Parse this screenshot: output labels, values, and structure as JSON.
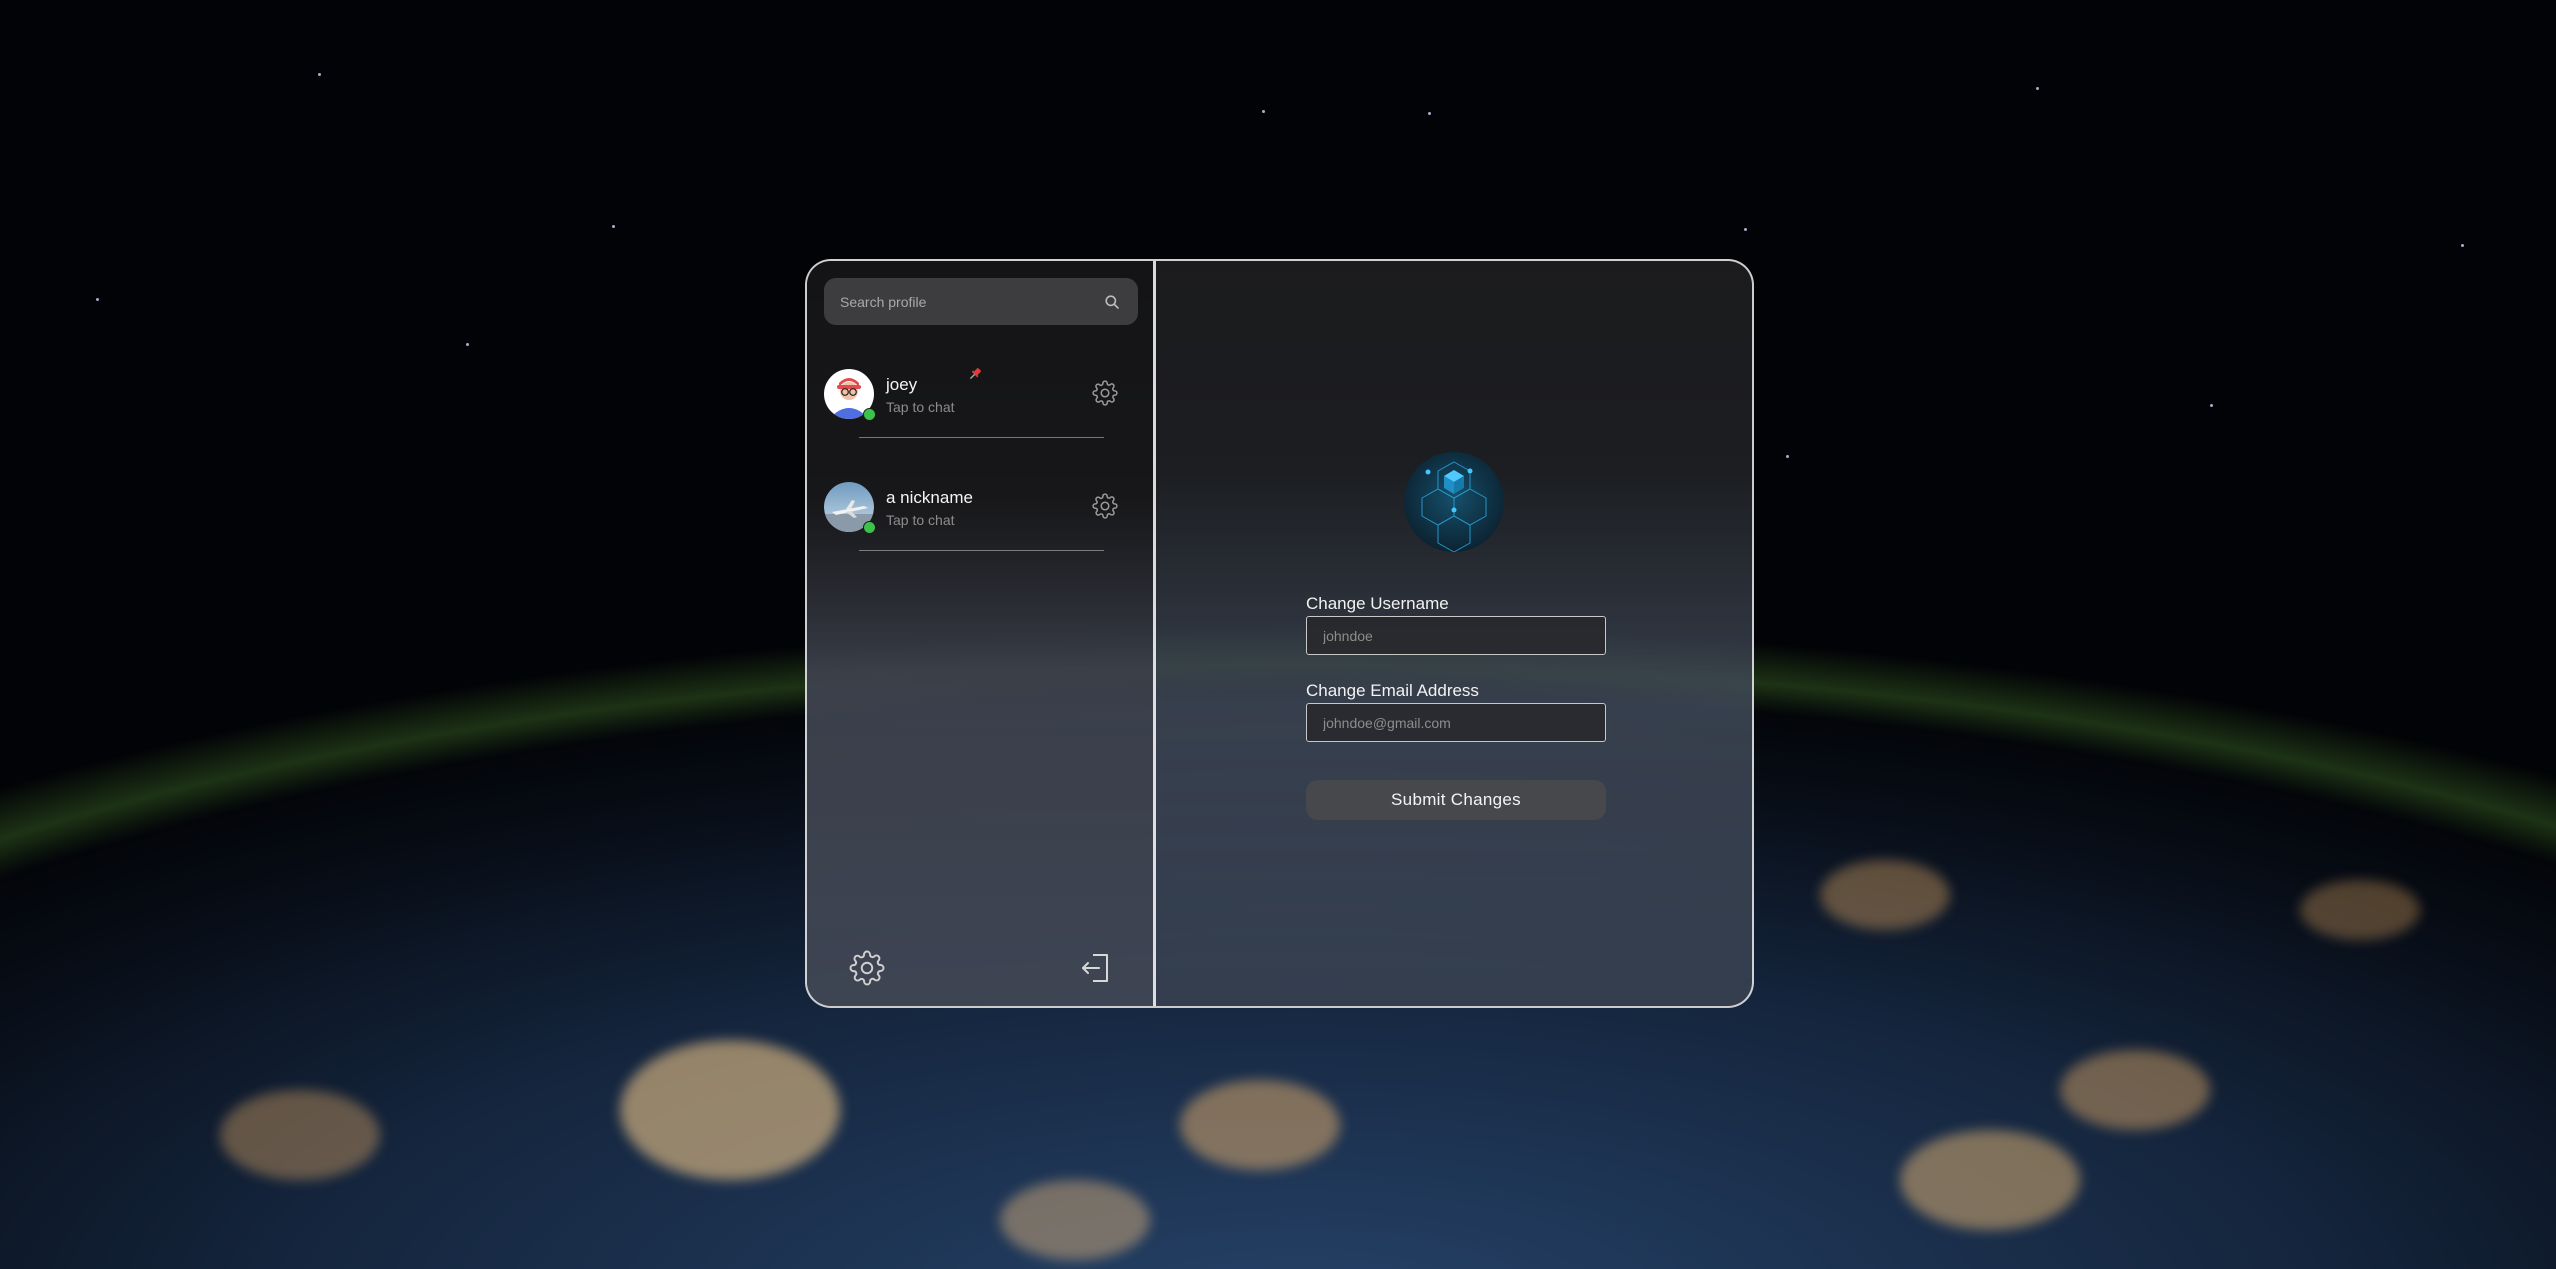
{
  "sidebar": {
    "search": {
      "placeholder": "Search profile"
    },
    "contacts": [
      {
        "name": "joey",
        "subtitle": "Tap to chat",
        "pinned": true,
        "online": true
      },
      {
        "name": "a nickname",
        "subtitle": "Tap to chat",
        "pinned": false,
        "online": true
      }
    ],
    "footer": {
      "settings_icon": "gear-icon",
      "logout_icon": "logout-icon"
    }
  },
  "main": {
    "username": {
      "label": "Change Username",
      "placeholder": "johndoe"
    },
    "email": {
      "label": "Change Email Address",
      "placeholder": "johndoe@gmail.com"
    },
    "submit_label": "Submit Changes"
  },
  "colors": {
    "online": "#3bc24a",
    "pin": "#e4393c",
    "logo_accent": "#29a8e0",
    "button": "#47484c"
  }
}
